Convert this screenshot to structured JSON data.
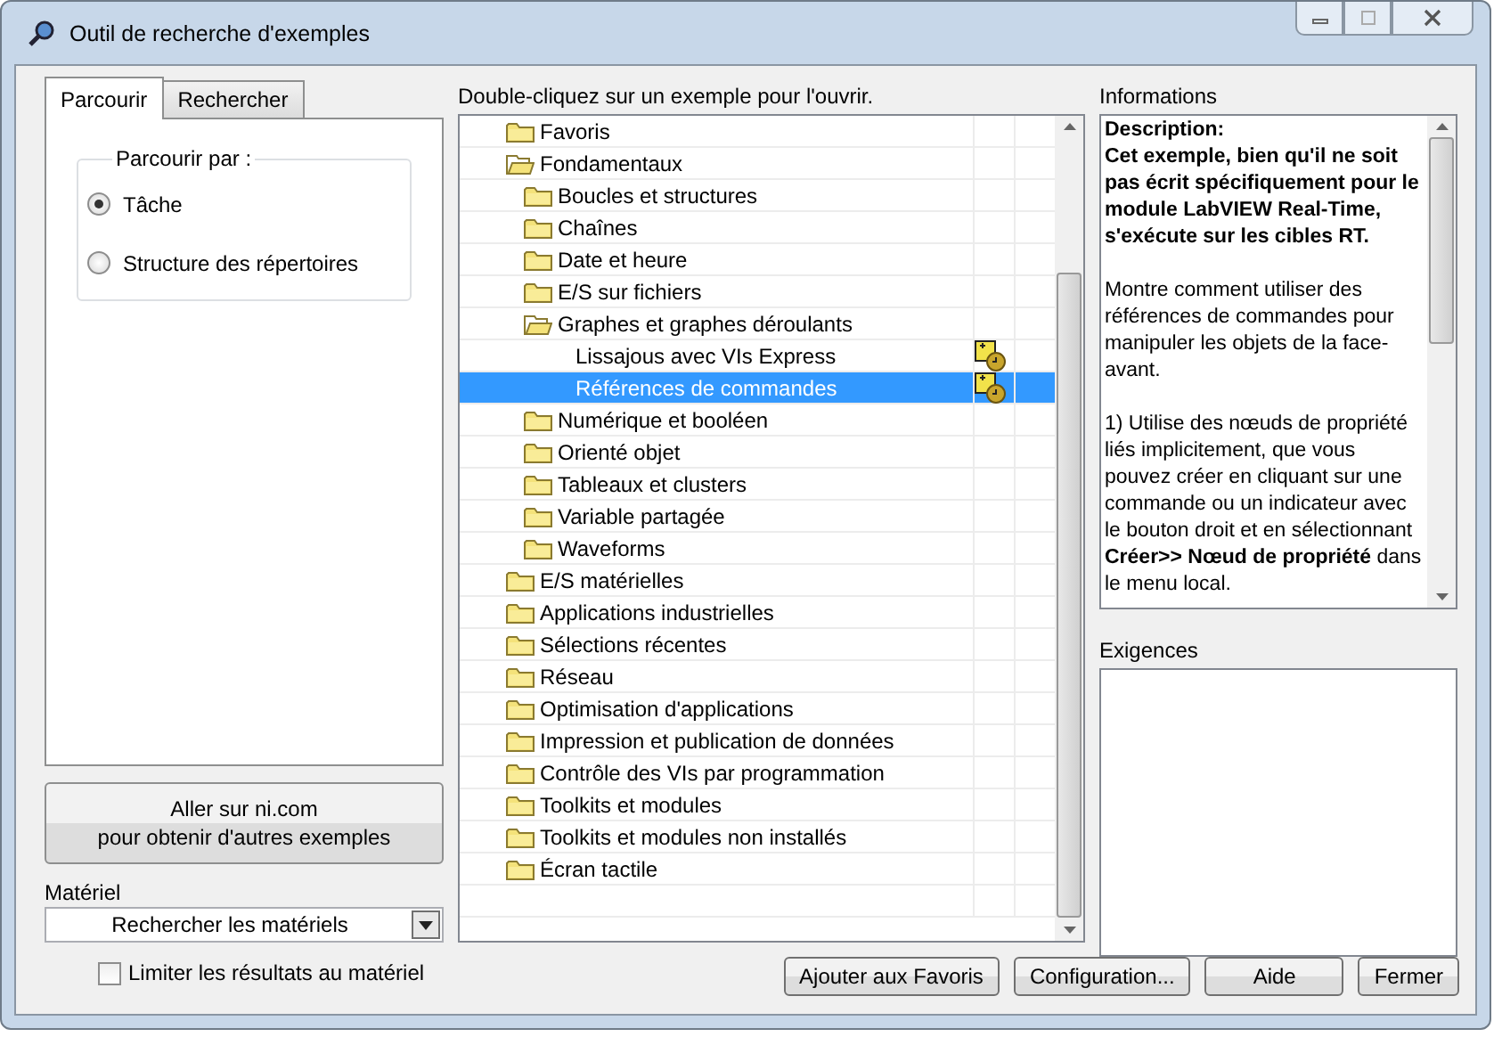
{
  "window": {
    "title": "Outil de recherche d'exemples"
  },
  "tabs": [
    {
      "label": "Parcourir",
      "selected": true
    },
    {
      "label": "Rechercher",
      "selected": false
    }
  ],
  "browse_by": {
    "legend": "Parcourir par :",
    "options": [
      {
        "label": "Tâche",
        "selected": true
      },
      {
        "label": "Structure des répertoires",
        "selected": false
      }
    ]
  },
  "ni_button": {
    "lines": [
      "Aller sur ni.com",
      "pour obtenir d'autres exemples"
    ]
  },
  "hardware": {
    "label": "Matériel",
    "value": "Rechercher les matériels"
  },
  "limit_checkbox": {
    "label": "Limiter les résultats au matériel",
    "checked": false
  },
  "tree": {
    "instruction": "Double-cliquez sur un exemple pour l'ouvrir.",
    "items": [
      {
        "kind": "folder",
        "label": "Favoris",
        "expanded": false,
        "selected": false
      },
      {
        "kind": "folder",
        "label": "Fondamentaux",
        "expanded": true,
        "selected": false,
        "children": [
          {
            "kind": "folder",
            "label": "Boucles et structures",
            "expanded": false,
            "selected": false
          },
          {
            "kind": "folder",
            "label": "Chaînes",
            "expanded": false,
            "selected": false
          },
          {
            "kind": "folder",
            "label": "Date et heure",
            "expanded": false,
            "selected": false
          },
          {
            "kind": "folder",
            "label": "E/S sur fichiers",
            "expanded": false,
            "selected": false
          },
          {
            "kind": "folder",
            "label": "Graphes et graphes déroulants",
            "expanded": true,
            "selected": false,
            "children": [
              {
                "kind": "example",
                "label": "Lissajous avec VIs Express",
                "selected": false
              },
              {
                "kind": "example",
                "label": "Références de commandes",
                "selected": true
              }
            ]
          },
          {
            "kind": "folder",
            "label": "Numérique et booléen",
            "expanded": false,
            "selected": false
          },
          {
            "kind": "folder",
            "label": "Orienté objet",
            "expanded": false,
            "selected": false
          },
          {
            "kind": "folder",
            "label": "Tableaux et clusters",
            "expanded": false,
            "selected": false
          },
          {
            "kind": "folder",
            "label": "Variable partagée",
            "expanded": false,
            "selected": false
          },
          {
            "kind": "folder",
            "label": "Waveforms",
            "expanded": false,
            "selected": false
          }
        ]
      },
      {
        "kind": "folder",
        "label": "E/S matérielles",
        "expanded": false,
        "selected": false
      },
      {
        "kind": "folder",
        "label": "Applications industrielles",
        "expanded": false,
        "selected": false
      },
      {
        "kind": "folder",
        "label": "Sélections récentes",
        "expanded": false,
        "selected": false
      },
      {
        "kind": "folder",
        "label": "Réseau",
        "expanded": false,
        "selected": false
      },
      {
        "kind": "folder",
        "label": "Optimisation d'applications",
        "expanded": false,
        "selected": false
      },
      {
        "kind": "folder",
        "label": "Impression et publication de données",
        "expanded": false,
        "selected": false
      },
      {
        "kind": "folder",
        "label": "Contrôle des VIs par programmation",
        "expanded": false,
        "selected": false
      },
      {
        "kind": "folder",
        "label": "Toolkits et modules",
        "expanded": false,
        "selected": false
      },
      {
        "kind": "folder",
        "label": "Toolkits et modules non installés",
        "expanded": false,
        "selected": false
      },
      {
        "kind": "folder",
        "label": "Écran tactile",
        "expanded": false,
        "selected": false
      }
    ]
  },
  "information": {
    "label": "Informations",
    "paragraphs": [
      {
        "kind": "heading",
        "text": "Description:\nCet exemple, bien qu'il ne soit pas écrit spécifiquement pour le module LabVIEW Real-Time, s'exécute sur les cibles RT."
      },
      {
        "kind": "body",
        "text": "Montre comment utiliser des références de commandes pour manipuler les objets de la face-avant."
      },
      {
        "kind": "body",
        "text": "1) Utilise des nœuds de propriété liés implicitement, que vous pouvez créer en cliquant sur une commande ou un indicateur avec le bouton droit et en sélectionnant **Créer>> Nœud de propriété** dans le menu local."
      }
    ]
  },
  "requirements": {
    "label": "Exigences"
  },
  "buttons": [
    "Ajouter aux Favoris",
    "Configuration...",
    "Aide",
    "Fermer"
  ]
}
